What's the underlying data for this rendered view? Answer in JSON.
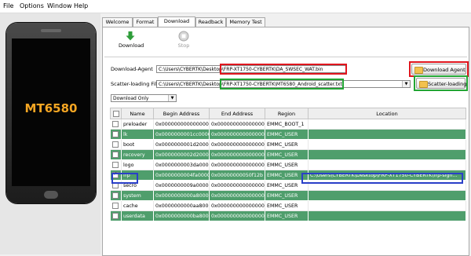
{
  "menu": {
    "items": [
      "File",
      "Options",
      "Window",
      "Help"
    ]
  },
  "device": {
    "chip": "MT6580"
  },
  "tabs": [
    "Welcome",
    "Format",
    "Download",
    "Readback",
    "Memory Test"
  ],
  "toolbar": {
    "download_label": "Download",
    "stop_label": "Stop"
  },
  "download_agent": {
    "label": "Download-Agent",
    "value": "C:\\Users\\CYBERTK\\Desktop\\FRP-XT1750-CYBERTK\\DA_SWSEC_WAT.bin",
    "button": "Download Agent"
  },
  "scatter": {
    "label": "Scatter-loading File",
    "value": "C:\\Users\\CYBERTK\\Desktop\\FRP-XT1750-CYBERTK\\MT6580_Android_scatter.txt",
    "button": "Scatter-loading"
  },
  "mode": {
    "selected": "Download Only"
  },
  "table": {
    "headers": [
      "",
      "Name",
      "Begin Address",
      "End Address",
      "Region",
      "Location"
    ],
    "rows": [
      {
        "name": "preloader",
        "begin": "0x0000000000000000",
        "end": "0x0000000000000000",
        "region": "EMMC_BOOT_1",
        "location": "",
        "checked": false,
        "green": false
      },
      {
        "name": "lk",
        "begin": "0x0000000001cc0000",
        "end": "0x0000000000000000",
        "region": "EMMC_USER",
        "location": "",
        "checked": false,
        "green": true
      },
      {
        "name": "boot",
        "begin": "0x0000000001d20000",
        "end": "0x0000000000000000",
        "region": "EMMC_USER",
        "location": "",
        "checked": false,
        "green": false
      },
      {
        "name": "recovery",
        "begin": "0x0000000002d20000",
        "end": "0x0000000000000000",
        "region": "EMMC_USER",
        "location": "",
        "checked": false,
        "green": true
      },
      {
        "name": "logo",
        "begin": "0x0000000003da0000",
        "end": "0x0000000000000000",
        "region": "EMMC_USER",
        "location": "",
        "checked": false,
        "green": false
      },
      {
        "name": "frp",
        "begin": "0x0000000004fa0000",
        "end": "0x00000000050f12b",
        "region": "EMMC_USER",
        "location": "C:\\Users\\CYBERTK\\Desktop\\FRP-XT1750-CYBERTK\\frp-sign...",
        "checked": true,
        "green": true
      },
      {
        "name": "secro",
        "begin": "0x0000000009a00000",
        "end": "0x0000000000000000",
        "region": "EMMC_USER",
        "location": "",
        "checked": false,
        "green": false
      },
      {
        "name": "system",
        "begin": "0x0000000000a800000",
        "end": "0x0000000000000000",
        "region": "EMMC_USER",
        "location": "",
        "checked": false,
        "green": true
      },
      {
        "name": "cache",
        "begin": "0x0000000000aa800000",
        "end": "0x0000000000000000",
        "region": "EMMC_USER",
        "location": "",
        "checked": false,
        "green": false
      },
      {
        "name": "userdata",
        "begin": "0x0000000000ba800000",
        "end": "0x0000000000000000",
        "region": "EMMC_USER",
        "location": "",
        "checked": false,
        "green": true
      }
    ]
  },
  "colors": {
    "row_green": "#4f9e6c",
    "highlight_red": "#e0161e",
    "highlight_green": "#22a534",
    "highlight_blue": "#2a3fc8",
    "chip_text": "#f5a623"
  }
}
